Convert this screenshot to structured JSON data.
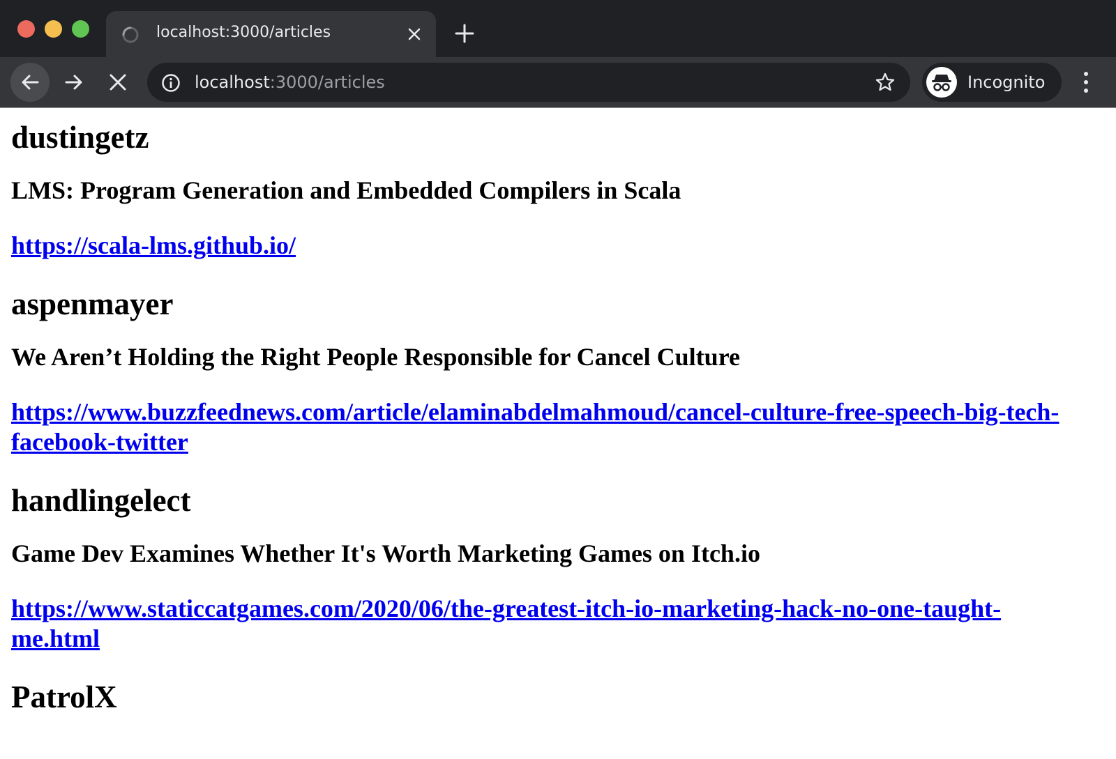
{
  "browser": {
    "tab": {
      "title": "localhost:3000/articles"
    },
    "omnibox": {
      "host": "localhost",
      "path": ":3000/articles"
    },
    "profile": {
      "label": "Incognito"
    }
  },
  "articles": [
    {
      "author": "dustingetz",
      "title": "LMS: Program Generation and Embedded Compilers in Scala",
      "url": "https://scala-lms.github.io/"
    },
    {
      "author": "aspenmayer",
      "title": "We Aren’t Holding the Right People Responsible for Cancel Culture",
      "url": "https://www.buzzfeednews.com/article/elaminabdelmahmoud/cancel-culture-free-speech-big-tech-facebook-twitter"
    },
    {
      "author": "handlingelect",
      "title": "Game Dev Examines Whether It's Worth Marketing Games on Itch.io",
      "url": "https://www.staticcatgames.com/2020/06/the-greatest-itch-io-marketing-hack-no-one-taught-me.html"
    },
    {
      "author": "PatrolX",
      "title": "",
      "url": ""
    }
  ]
}
